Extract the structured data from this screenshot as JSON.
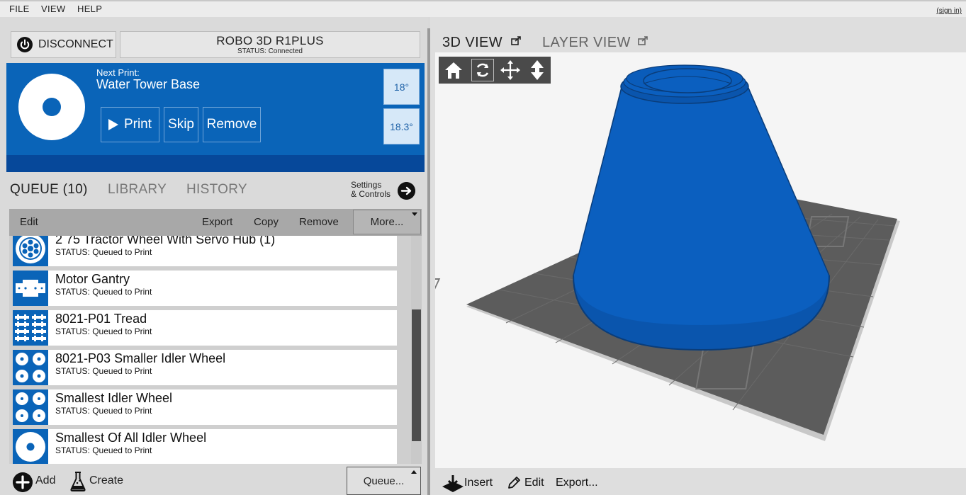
{
  "menubar": {
    "items": [
      "FILE",
      "VIEW",
      "HELP"
    ],
    "sign_in": "(sign in)"
  },
  "printer": {
    "disconnect_label": "DISCONNECT",
    "name": "ROBO 3D R1PLUS",
    "status": "STATUS: Connected"
  },
  "next_print": {
    "label": "Next Print:",
    "name": "Water Tower Base",
    "print_label": "Print",
    "skip_label": "Skip",
    "remove_label": "Remove",
    "temps": [
      "18°",
      "18.3°"
    ]
  },
  "tabs": {
    "queue": "QUEUE (10)",
    "library": "LIBRARY",
    "history": "HISTORY"
  },
  "settings": {
    "line1": "Settings",
    "line2": "& Controls"
  },
  "toolbar": {
    "edit": "Edit",
    "export": "Export",
    "copy": "Copy",
    "remove": "Remove",
    "more": "More..."
  },
  "queue_items": [
    {
      "title": "2 75 Tractor Wheel With Servo Hub (1)",
      "status": "STATUS: Queued to Print",
      "icon": "tractor-wheel-icon"
    },
    {
      "title": "Motor Gantry",
      "status": "STATUS: Queued to Print",
      "icon": "gantry-icon"
    },
    {
      "title": "8021-P01 Tread",
      "status": "STATUS: Queued to Print",
      "icon": "tread-icon"
    },
    {
      "title": "8021-P03 Smaller Idler Wheel",
      "status": "STATUS: Queued to Print",
      "icon": "four-wheels-icon"
    },
    {
      "title": "Smallest Idler Wheel",
      "status": "STATUS: Queued to Print",
      "icon": "four-wheels-icon"
    },
    {
      "title": "Smallest Of All Idler Wheel",
      "status": "STATUS: Queued to Print",
      "icon": "ring-icon"
    }
  ],
  "bottom_left": {
    "add": "Add",
    "create": "Create",
    "queue": "Queue..."
  },
  "view_tabs": {
    "view3d": "3D VIEW",
    "layer": "LAYER VIEW"
  },
  "view_bottom": {
    "insert": "Insert",
    "edit": "Edit",
    "export": "Export..."
  },
  "colors": {
    "accent": "#0a64b8",
    "model": "#0b5fbf",
    "bed": "#5a5a5a"
  }
}
